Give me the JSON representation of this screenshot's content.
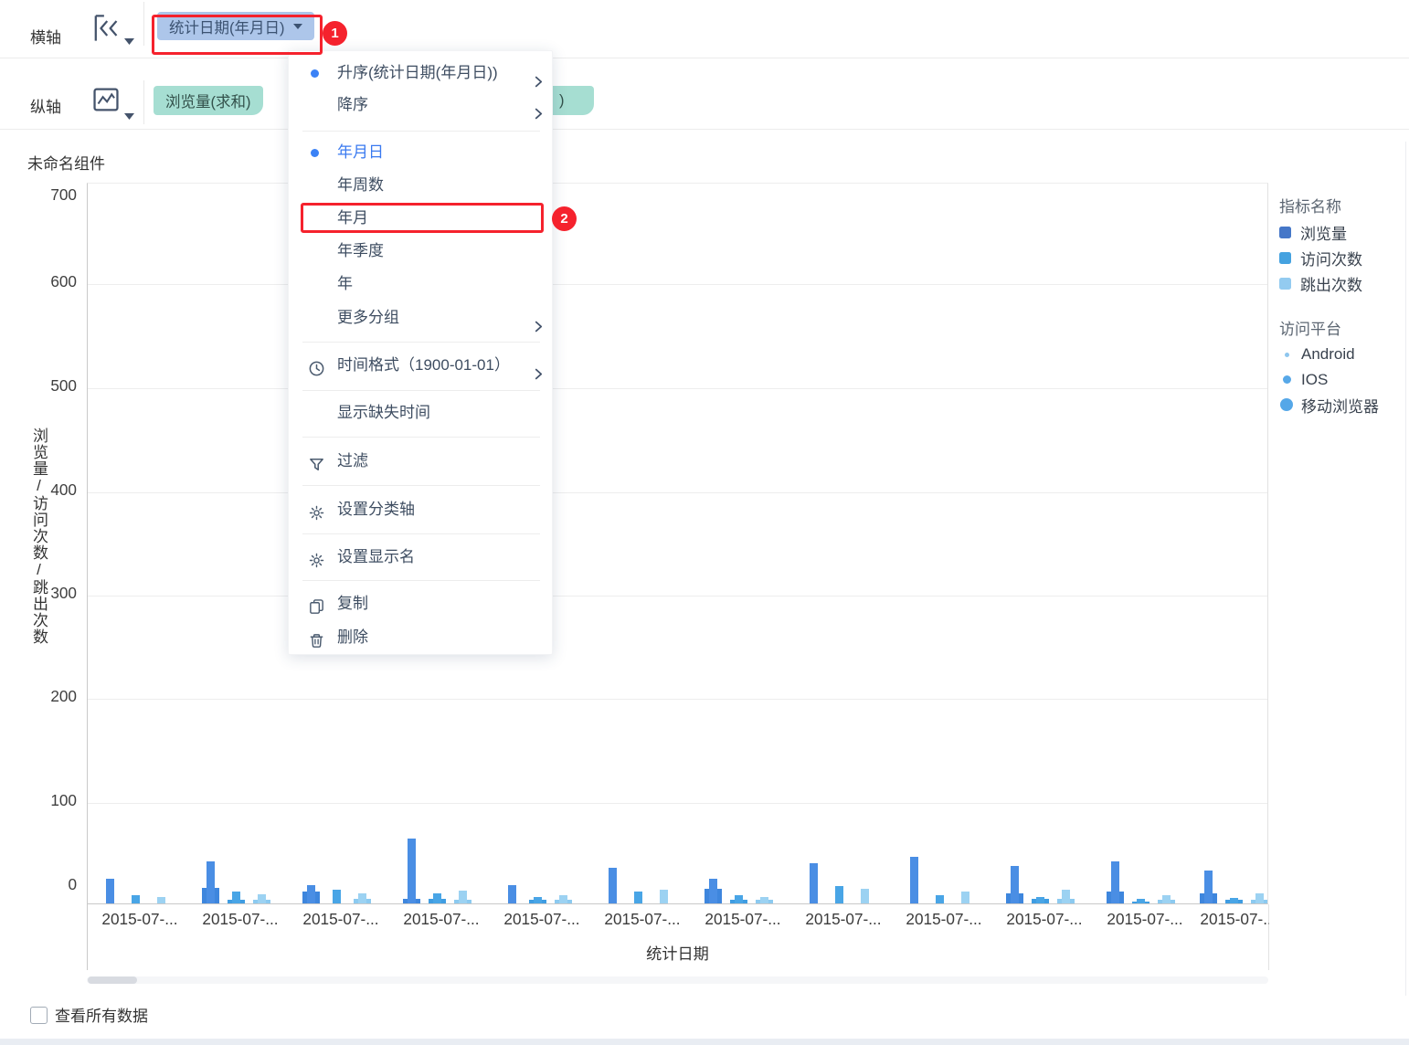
{
  "colors": {
    "accent_blue": "#3b82f6",
    "annotation_red": "#f5222d",
    "date_pill_bg": "#adc6ea",
    "measure_pill_bg": "#a6ded2"
  },
  "annotations": {
    "step1_badge": "1",
    "step2_badge": "2"
  },
  "axis_rows": {
    "horizontal": {
      "label": "横轴",
      "pill": "统计日期(年月日)"
    },
    "vertical": {
      "label": "纵轴",
      "pill1": "浏览量(求和)",
      "pill2_fragment": ")"
    }
  },
  "menu": {
    "items": [
      {
        "label": "升序(统计日期(年月日))",
        "bullet": true,
        "arrow": true
      },
      {
        "label": "降序",
        "arrow": true,
        "divider_after": true
      },
      {
        "label": "年月日",
        "bullet": true,
        "selected": true
      },
      {
        "label": "年周数"
      },
      {
        "label": "年月",
        "highlighted": true
      },
      {
        "label": "年季度"
      },
      {
        "label": "年"
      },
      {
        "label": "更多分组",
        "arrow": true,
        "divider_after": true
      },
      {
        "label": "时间格式（1900-01-01）",
        "icon": "clock",
        "arrow": true,
        "divider_after": true
      },
      {
        "label": "显示缺失时间",
        "divider_after": true
      },
      {
        "label": "过滤",
        "icon": "filter",
        "divider_after": true
      },
      {
        "label": "设置分类轴",
        "icon": "gear",
        "divider_after": true
      },
      {
        "label": "设置显示名",
        "icon": "gear",
        "divider_after": true
      },
      {
        "label": "复制",
        "icon": "copy"
      },
      {
        "label": "删除",
        "icon": "trash"
      }
    ]
  },
  "chart": {
    "title": "未命名组件",
    "legend": {
      "metric_header": "指标名称",
      "metrics": [
        {
          "label": "浏览量",
          "color": "#4577c8"
        },
        {
          "label": "访问次数",
          "color": "#45a2e0"
        },
        {
          "label": "跳出次数",
          "color": "#93cbf0"
        }
      ],
      "platform_header": "访问平台",
      "platforms": [
        {
          "label": "Android",
          "size": 5,
          "color": "#8ec6ee"
        },
        {
          "label": "IOS",
          "size": 9,
          "color": "#57a8e8"
        },
        {
          "label": "移动浏览器",
          "size": 14,
          "color": "#55a7e8"
        }
      ]
    }
  },
  "chart_data": {
    "type": "bar",
    "title": "未命名组件",
    "xlabel": "统计日期",
    "ylabel": "浏览量/访问次数/跳出次数",
    "ylim": [
      0,
      700
    ],
    "y_ticks": [
      700,
      600,
      500,
      400,
      300,
      200,
      100,
      0
    ],
    "grid": true,
    "legend_position": "right",
    "categories": [
      "2015-07-...",
      "2015-07-...",
      "2015-07-...",
      "2015-07-...",
      "2015-07-...",
      "2015-07-...",
      "2015-07-...",
      "2015-07-...",
      "2015-07-...",
      "2015-07-...",
      "2015-07-...",
      "2015-07-..."
    ],
    "series": [
      {
        "name": "浏览量",
        "color": "#4a8ee4",
        "overlay_color": "#3e86dd",
        "values": [
          25,
          42,
          19,
          64,
          19,
          35,
          25,
          40,
          46,
          37,
          42,
          33
        ],
        "wide_bar_values": [
          0,
          16,
          12,
          5,
          0,
          0,
          15,
          0,
          0,
          11,
          12,
          11
        ]
      },
      {
        "name": "访问次数",
        "color": "#49a5e6",
        "overlay_color": "#3f9de2",
        "values": [
          9,
          12,
          14,
          11,
          7,
          12,
          9,
          18,
          9,
          7,
          5,
          6
        ],
        "wide_bar_values": [
          0,
          4,
          0,
          5,
          4,
          0,
          4,
          0,
          0,
          5,
          3,
          4
        ]
      },
      {
        "name": "跳出次数",
        "color": "#9cd2f2",
        "overlay_color": "#8ccaf0",
        "values": [
          7,
          10,
          11,
          13,
          9,
          14,
          7,
          15,
          12,
          14,
          9,
          11
        ],
        "wide_bar_values": [
          0,
          4,
          5,
          4,
          4,
          0,
          4,
          0,
          0,
          5,
          4,
          4
        ]
      }
    ]
  },
  "footer": {
    "checkbox_label": "查看所有数据"
  }
}
